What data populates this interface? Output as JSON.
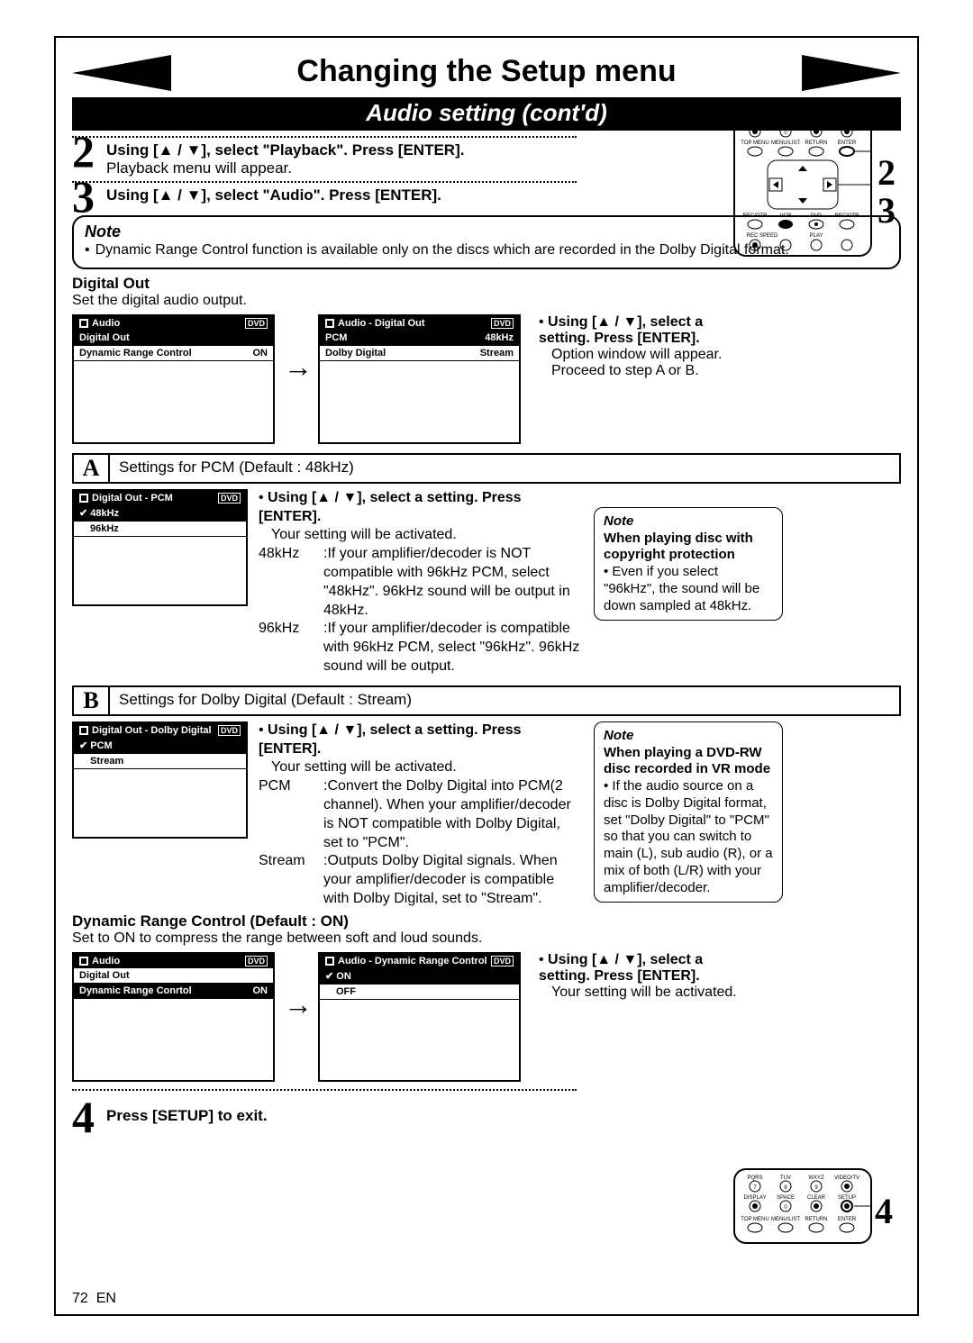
{
  "header": {
    "title": "Changing the Setup menu",
    "subtitle": "Audio setting (cont'd)"
  },
  "step2": {
    "num": "2",
    "bold": "Using [▲ / ▼], select \"Playback\". Press [ENTER].",
    "text": "Playback menu will appear."
  },
  "step3": {
    "num": "3",
    "bold": "Using [▲ / ▼], select \"Audio\". Press [ENTER]."
  },
  "remote_side": {
    "a": "2",
    "b": "3"
  },
  "note_top": {
    "title": "Note",
    "bullet": "Dynamic Range Control function is available only on the discs which are recorded in the Dolby Digital format."
  },
  "digital_out": {
    "heading": "Digital Out",
    "sub": "Set the digital audio output."
  },
  "osd1": {
    "title": "Audio",
    "dvd": "DVD",
    "row1a": "Digital Out",
    "row1b": "",
    "row2a": "Dynamic Range Control",
    "row2b": "ON"
  },
  "osd2": {
    "title": "Audio - Digital Out",
    "dvd": "DVD",
    "row1a": "PCM",
    "row1b": "48kHz",
    "row2a": "Dolby Digital",
    "row2b": "Stream"
  },
  "right_instr1": {
    "b1": "Using [▲ / ▼], select a setting. Press [ENTER].",
    "t1": "Option window will appear.",
    "t2": "Proceed to step A or B."
  },
  "letterA": {
    "letter": "A",
    "text": "Settings for PCM (Default : 48kHz)"
  },
  "osdA": {
    "title": "Digital Out - PCM",
    "dvd": "DVD",
    "row1": "48kHz",
    "row2": "96kHz"
  },
  "instrA": {
    "b1": "Using [▲ / ▼], select a setting. Press [ENTER].",
    "t1": "Your setting will be activated.",
    "d1l": "48kHz",
    "d1t": ":If your amplifier/decoder is NOT compatible with 96kHz PCM, select \"48kHz\". 96kHz sound will be output in 48kHz.",
    "d2l": "96kHz",
    "d2t": ":If your amplifier/decoder is compatible with 96kHz PCM, select \"96kHz\". 96kHz sound will be output."
  },
  "noteA": {
    "title": "Note",
    "b": "When playing disc with copyright protection",
    "t": "Even if you select \"96kHz\", the sound will be down sampled at 48kHz."
  },
  "letterB": {
    "letter": "B",
    "text": "Settings for Dolby Digital (Default : Stream)"
  },
  "osdB": {
    "title": "Digital Out - Dolby Digital",
    "dvd": "DVD",
    "row1": "PCM",
    "row2": "Stream"
  },
  "instrB": {
    "b1": "Using [▲ / ▼], select a setting. Press [ENTER].",
    "t1": "Your setting will be activated.",
    "d1l": "PCM",
    "d1t": ":Convert the Dolby Digital into PCM(2 channel). When your amplifier/decoder is NOT compatible with Dolby Digital, set to \"PCM\".",
    "d2l": "Stream",
    "d2t": ":Outputs Dolby Digital signals. When your amplifier/decoder is compatible with Dolby Digital, set to \"Stream\"."
  },
  "noteB": {
    "title": "Note",
    "b": "When playing a DVD-RW disc recorded in VR mode",
    "t": "If the audio source on a disc is Dolby Digital format, set \"Dolby Digital\" to \"PCM\" so that you can switch to main (L), sub audio (R), or a mix of both (L/R) with your amplifier/decoder."
  },
  "drc": {
    "heading": "Dynamic Range Control (Default : ON)",
    "sub": "Set to ON to compress the range between soft and loud sounds."
  },
  "osdD1": {
    "title": "Audio",
    "dvd": "DVD",
    "row1a": "Digital Out",
    "row1b": "",
    "row2a": "Dynamic Range Conrtol",
    "row2b": "ON"
  },
  "osdD2": {
    "title": "Audio - Dynamic Range Control",
    "dvd": "DVD",
    "row1": "ON",
    "row2": "OFF"
  },
  "right_instr2": {
    "b1": "Using [▲ / ▼], select a setting. Press [ENTER].",
    "t1": "Your setting will be activated."
  },
  "step4": {
    "num": "4",
    "bold": "Press [SETUP] to exit.",
    "side": "4"
  },
  "footer": {
    "page": "72",
    "lang": "EN"
  },
  "remote_labels": {
    "r1": [
      "DISPLAY",
      "SPACE",
      "CLEAR",
      "SETUP"
    ],
    "r2": [
      "TOP MENU",
      "MENU/LIST",
      "RETURN",
      "ENTER"
    ],
    "r3": [
      "REC/OTR",
      "VCR",
      "DVD",
      "REC/OTR"
    ],
    "r4": [
      "REC SPEED",
      "",
      "PLAY",
      ""
    ],
    "b1": [
      "PQRS",
      "TUV",
      "WXYZ",
      "VIDEO/TV"
    ],
    "b2": [
      "7",
      "8",
      "9",
      ""
    ],
    "b3": [
      "DISPLAY",
      "SPACE",
      "CLEAR",
      "SETUP"
    ],
    "b4": [
      "TOP MENU",
      "MENU/LIST",
      "RETURN",
      "ENTER"
    ]
  }
}
